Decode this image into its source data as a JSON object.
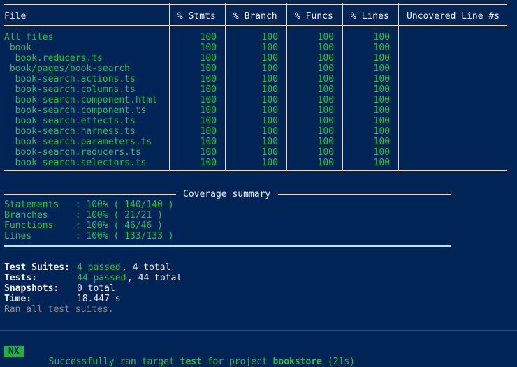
{
  "table": {
    "headers": [
      "File",
      "% Stmts",
      "% Branch",
      "% Funcs",
      "% Lines",
      "Uncovered Line #s"
    ],
    "rows": [
      {
        "file": "All files",
        "stmts": "100",
        "branch": "100",
        "funcs": "100",
        "lines": "100",
        "uncovered": ""
      },
      {
        "file": " book",
        "stmts": "100",
        "branch": "100",
        "funcs": "100",
        "lines": "100",
        "uncovered": ""
      },
      {
        "file": "  book.reducers.ts",
        "stmts": "100",
        "branch": "100",
        "funcs": "100",
        "lines": "100",
        "uncovered": ""
      },
      {
        "file": " book/pages/book-search",
        "stmts": "100",
        "branch": "100",
        "funcs": "100",
        "lines": "100",
        "uncovered": ""
      },
      {
        "file": "  book-search.actions.ts",
        "stmts": "100",
        "branch": "100",
        "funcs": "100",
        "lines": "100",
        "uncovered": ""
      },
      {
        "file": "  book-search.columns.ts",
        "stmts": "100",
        "branch": "100",
        "funcs": "100",
        "lines": "100",
        "uncovered": ""
      },
      {
        "file": "  book-search.component.html",
        "stmts": "100",
        "branch": "100",
        "funcs": "100",
        "lines": "100",
        "uncovered": ""
      },
      {
        "file": "  book-search.component.ts",
        "stmts": "100",
        "branch": "100",
        "funcs": "100",
        "lines": "100",
        "uncovered": ""
      },
      {
        "file": "  book-search.effects.ts",
        "stmts": "100",
        "branch": "100",
        "funcs": "100",
        "lines": "100",
        "uncovered": ""
      },
      {
        "file": "  book-search.harness.ts",
        "stmts": "100",
        "branch": "100",
        "funcs": "100",
        "lines": "100",
        "uncovered": ""
      },
      {
        "file": "  book-search.parameters.ts",
        "stmts": "100",
        "branch": "100",
        "funcs": "100",
        "lines": "100",
        "uncovered": ""
      },
      {
        "file": "  book-search.reducers.ts",
        "stmts": "100",
        "branch": "100",
        "funcs": "100",
        "lines": "100",
        "uncovered": ""
      },
      {
        "file": "  book-search.selectors.ts",
        "stmts": "100",
        "branch": "100",
        "funcs": "100",
        "lines": "100",
        "uncovered": ""
      }
    ]
  },
  "summary": {
    "title": "Coverage summary",
    "items": [
      {
        "label": "Statements   : 100% ( 140/140 )"
      },
      {
        "label": "Branches     : 100% ( 21/21 )"
      },
      {
        "label": "Functions    : 100% ( 46/46 )"
      },
      {
        "label": "Lines        : 100% ( 133/133 )"
      }
    ]
  },
  "results": {
    "suites_label": "Test Suites:",
    "suites_passed": "4 passed",
    "suites_total": ", 4 total",
    "tests_label": "Tests:",
    "tests_passed": "44 passed",
    "tests_total": ", 44 total",
    "snapshots_label": "Snapshots:",
    "snapshots_value": "0 total",
    "time_label": "Time:",
    "time_value": "18.447 s",
    "ran_all": "Ran all test suites."
  },
  "nx": {
    "badge": "NX",
    "msg_prefix": "Successfully ran target ",
    "target": "test",
    "msg_middle": " for project ",
    "project": "bookstore",
    "duration": " (21s)"
  },
  "colors": {
    "background": "#012456",
    "green": "#23c843",
    "dim": "#8a8a8a",
    "badge": "#1fb33a"
  }
}
